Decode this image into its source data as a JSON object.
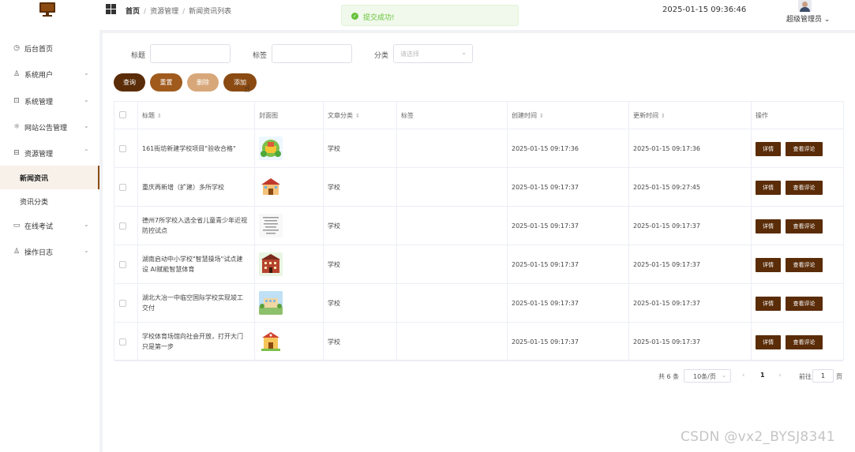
{
  "header": {
    "breadcrumb": [
      "首页",
      "资源管理",
      "新闻资讯列表"
    ],
    "toast": "提交成功!",
    "datetime": "2025-01-15 09:36:46",
    "user": "超级管理员"
  },
  "sidebar": {
    "items": [
      {
        "label": "后台首页",
        "icon": "clock-icon"
      },
      {
        "label": "系统用户",
        "icon": "user-icon"
      },
      {
        "label": "系统管理",
        "icon": "settings-icon"
      },
      {
        "label": "网站公告管理",
        "icon": "sun-icon"
      },
      {
        "label": "资源管理",
        "icon": "folder-icon"
      },
      {
        "label": "新闻资讯",
        "icon": ""
      },
      {
        "label": "资讯分类",
        "icon": ""
      },
      {
        "label": "在线考试",
        "icon": "monitor-icon"
      },
      {
        "label": "操作日志",
        "icon": "person-icon"
      }
    ]
  },
  "filters": {
    "title_label": "标题",
    "tag_label": "标签",
    "category_label": "分类",
    "category_placeholder": "请选择"
  },
  "buttons": {
    "query": "查询",
    "reset": "重置",
    "delete": "删除",
    "add": "添加"
  },
  "table": {
    "headers": [
      "标题",
      "封面图",
      "文章分类",
      "标签",
      "创建时间",
      "更新时间",
      "操作"
    ],
    "rows": [
      {
        "title": "161街坊新建学校项目\"验收合格\"",
        "category": "学校",
        "tag": "",
        "created": "2025-01-15 09:17:36",
        "updated": "2025-01-15 09:17:36"
      },
      {
        "title": "重庆再新增（扩建）多所学校",
        "category": "学校",
        "tag": "",
        "created": "2025-01-15 09:17:37",
        "updated": "2025-01-15 09:27:45"
      },
      {
        "title": "德州7所学校入选全省儿童青少年近视防控试点",
        "category": "学校",
        "tag": "",
        "created": "2025-01-15 09:17:37",
        "updated": "2025-01-15 09:17:37"
      },
      {
        "title": "湖南启动中小学校\"智慧操场\"试点建设 AI赋能智慧体育",
        "category": "学校",
        "tag": "",
        "created": "2025-01-15 09:17:37",
        "updated": "2025-01-15 09:17:37"
      },
      {
        "title": "湖北大冶一中临空国际学校实现竣工交付",
        "category": "学校",
        "tag": "",
        "created": "2025-01-15 09:17:37",
        "updated": "2025-01-15 09:17:37"
      },
      {
        "title": "学校体育场馆向社会开放，打开大门只是第一步",
        "category": "学校",
        "tag": "",
        "created": "2025-01-15 09:17:37",
        "updated": "2025-01-15 09:17:37"
      }
    ],
    "action_detail": "详情",
    "action_comments": "查看评论"
  },
  "pagination": {
    "total": "共 6 条",
    "page_size": "10条/页",
    "current": "1",
    "goto_label": "前往",
    "goto_value": "1",
    "goto_unit": "页"
  },
  "watermark": "CSDN @vx2_BYSJ8341",
  "colors": {
    "primary": "#5a2c08",
    "accent": "#8a4a12",
    "success": "#67c23a"
  }
}
